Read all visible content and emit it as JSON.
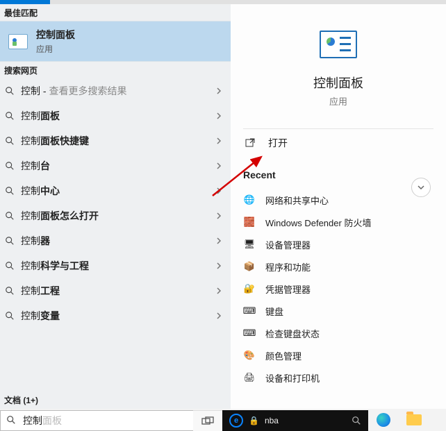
{
  "left": {
    "best_match_header": "最佳匹配",
    "best_match": {
      "title": "控制面板",
      "subtitle": "应用"
    },
    "search_web_header": "搜索网页",
    "suggestions": [
      {
        "pre": "控制",
        "bold": "",
        "hint": "查看更多搜索结果"
      },
      {
        "pre": "控制",
        "bold": "面板",
        "hint": ""
      },
      {
        "pre": "控制",
        "bold": "面板快捷键",
        "hint": ""
      },
      {
        "pre": "控制",
        "bold": "台",
        "hint": ""
      },
      {
        "pre": "控制",
        "bold": "中心",
        "hint": ""
      },
      {
        "pre": "控制",
        "bold": "面板怎么打开",
        "hint": ""
      },
      {
        "pre": "控制",
        "bold": "器",
        "hint": ""
      },
      {
        "pre": "控制",
        "bold": "科学与工程",
        "hint": ""
      },
      {
        "pre": "控制",
        "bold": "工程",
        "hint": ""
      },
      {
        "pre": "控制",
        "bold": "变量",
        "hint": ""
      }
    ],
    "docs_header": "文档 (1+)"
  },
  "right": {
    "app_name": "控制面板",
    "app_type": "应用",
    "open_label": "打开",
    "recent_header": "Recent",
    "recent": [
      {
        "label": "网络和共享中心",
        "icon": "🌐"
      },
      {
        "label": "Windows Defender 防火墙",
        "icon": "🧱"
      },
      {
        "label": "设备管理器",
        "icon": "🖥"
      },
      {
        "label": "程序和功能",
        "icon": "📦"
      },
      {
        "label": "凭据管理器",
        "icon": "🔐"
      },
      {
        "label": "键盘",
        "icon": "⌨"
      },
      {
        "label": "检查键盘状态",
        "icon": "⌨"
      },
      {
        "label": "颜色管理",
        "icon": "🎨"
      },
      {
        "label": "设备和打印机",
        "icon": "🖨"
      }
    ]
  },
  "taskbar": {
    "query_active": "控制",
    "query_ghost": "面板",
    "edge_text": "nba"
  }
}
